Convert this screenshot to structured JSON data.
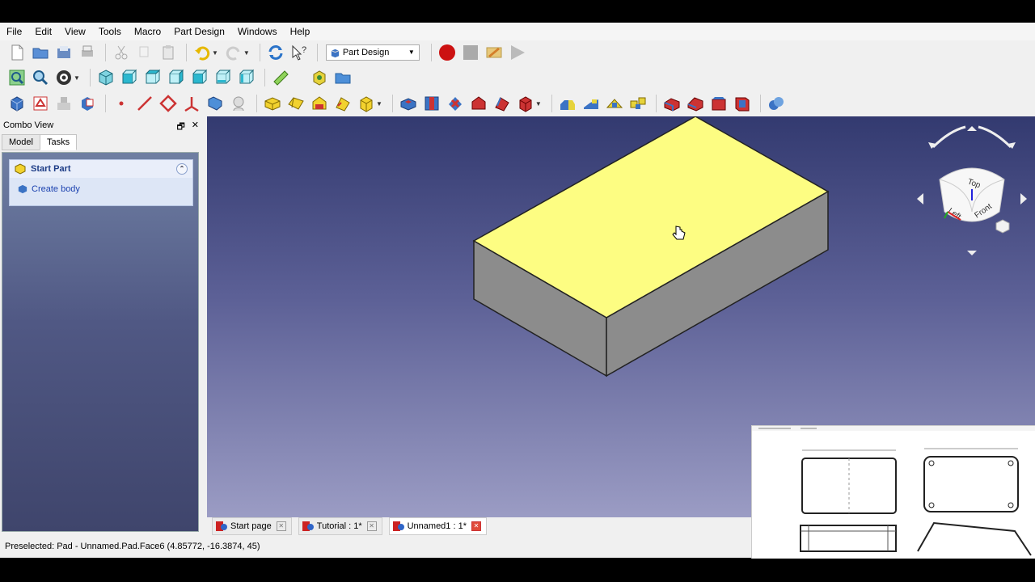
{
  "menu": [
    "File",
    "Edit",
    "View",
    "Tools",
    "Macro",
    "Part Design",
    "Windows",
    "Help"
  ],
  "workbench": {
    "selected": "Part Design"
  },
  "combo_view": {
    "title": "Combo View",
    "tabs": [
      {
        "label": "Model"
      },
      {
        "label": "Tasks"
      }
    ],
    "task": {
      "title": "Start Part",
      "action": "Create body"
    }
  },
  "navcube": {
    "top": "Top",
    "left": "Left",
    "front": "Front"
  },
  "doc_tabs": [
    {
      "label": "Start page"
    },
    {
      "label": "Tutorial : 1*"
    },
    {
      "label": "Unnamed1 : 1*"
    }
  ],
  "status": {
    "text": "Preselected: Pad - Unnamed.Pad.Face6 (4.85772, -16.3874, 45)"
  },
  "colors": {
    "face_top": "#fdfd82",
    "face_side": "#8c8c8c",
    "record": "#cc1111",
    "viewport_top": "#333a70",
    "viewport_bottom": "#9b9cc4"
  }
}
